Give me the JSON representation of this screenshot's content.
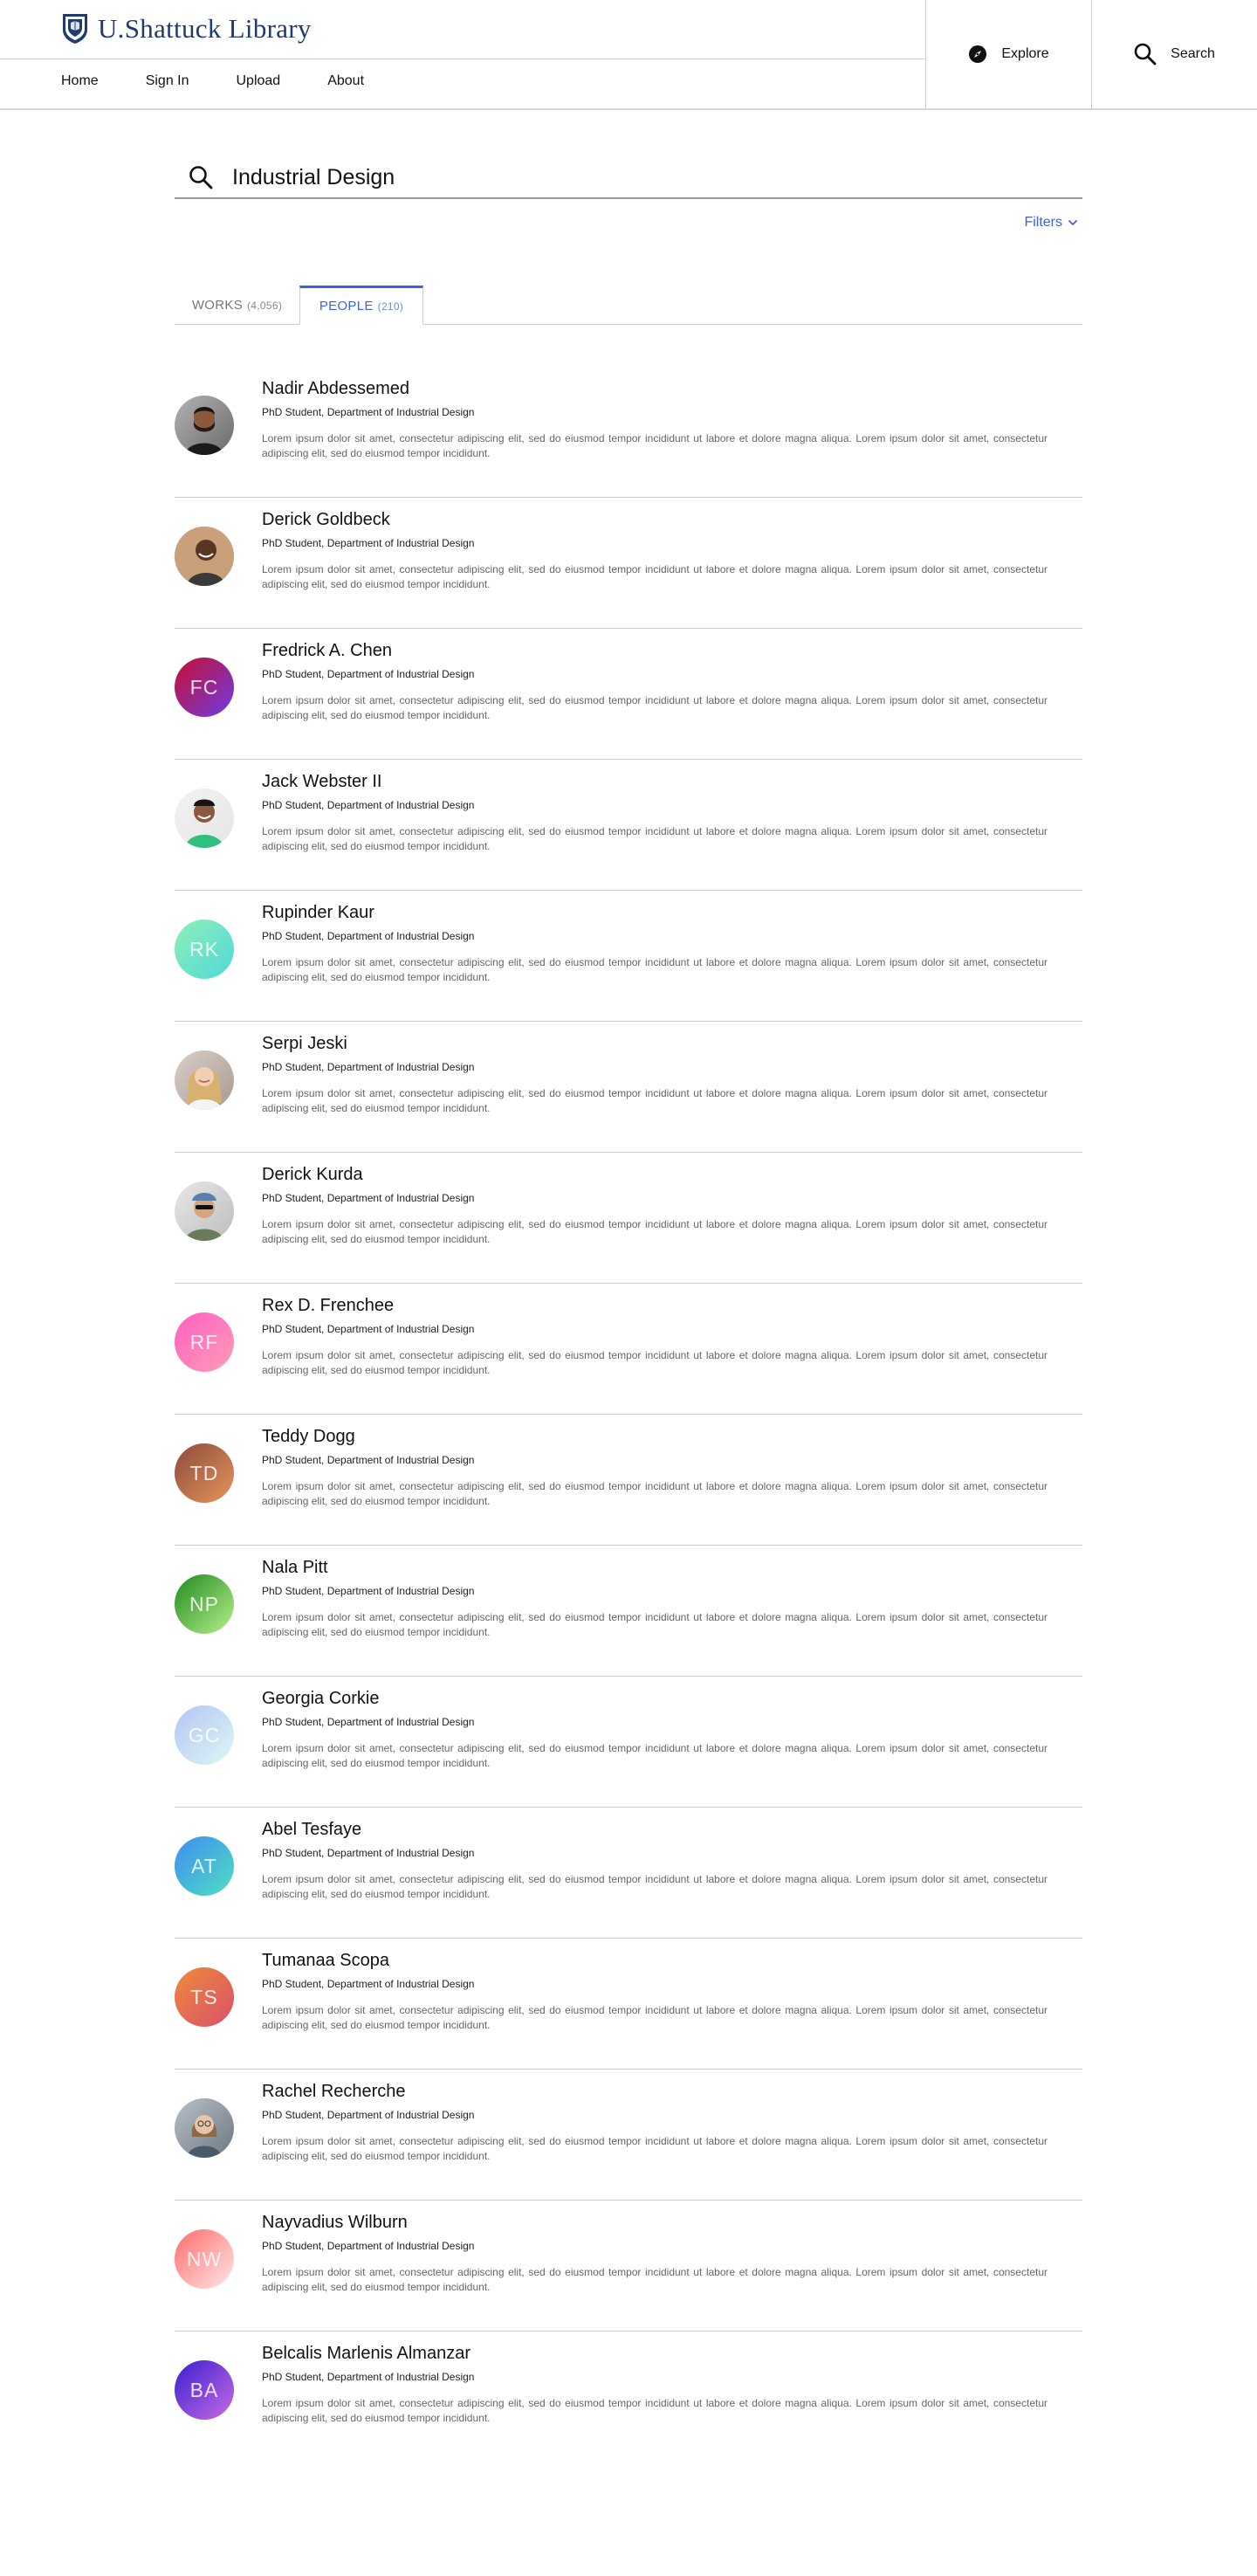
{
  "header": {
    "logo_text": "U.Shattuck Library",
    "nav": [
      {
        "label": "Home"
      },
      {
        "label": "Sign In"
      },
      {
        "label": "Upload"
      },
      {
        "label": "About"
      }
    ],
    "explore_label": "Explore",
    "search_label": "Search",
    "logo_color": "#1f3b6f"
  },
  "search": {
    "query": "Industrial Design",
    "filters_label": "Filters"
  },
  "tabs": {
    "works": {
      "label": "WORKS",
      "count": "(4,056)"
    },
    "people": {
      "label": "PEOPLE",
      "count": "(210)"
    },
    "active": "people",
    "accent": "#3d63d8"
  },
  "people": [
    {
      "name": "Nadir Abdessemed",
      "role": "PhD Student, Department of Industrial Design",
      "desc": "Lorem ipsum dolor sit amet, consectetur adipiscing elit, sed do eiusmod tempor incididunt ut labore et dolore magna aliqua. Lorem ipsum dolor sit amet, consectetur adipiscing elit, sed do eiusmod tempor incididunt.",
      "initials": "",
      "photo": "man-beard",
      "color_from": "#b3b3b3",
      "color_to": "#6a6a6a"
    },
    {
      "name": "Derick Goldbeck",
      "role": "PhD Student, Department of Industrial Design",
      "desc": "Lorem ipsum dolor sit amet, consectetur adipiscing elit, sed do eiusmod tempor incididunt ut labore et dolore magna aliqua. Lorem ipsum dolor sit amet, consectetur adipiscing elit, sed do eiusmod tempor incididunt.",
      "initials": "",
      "photo": "man-smiling",
      "color_from": "#b8c3cc",
      "color_to": "#7a8690"
    },
    {
      "name": "Fredrick A. Chen",
      "role": "PhD Student, Department of Industrial Design",
      "desc": "Lorem ipsum dolor sit amet, consectetur adipiscing elit, sed do eiusmod tempor incididunt ut labore et dolore magna aliqua. Lorem ipsum dolor sit amet, consectetur adipiscing elit, sed do eiusmod tempor incididunt.",
      "initials": "FC",
      "photo": "",
      "color_from": "#c8102e",
      "color_to": "#6d3be6"
    },
    {
      "name": "Jack Webster II",
      "role": "PhD Student, Department of Industrial Design",
      "desc": "Lorem ipsum dolor sit amet, consectetur adipiscing elit, sed do eiusmod tempor incididunt ut labore et dolore magna aliqua. Lorem ipsum dolor sit amet, consectetur adipiscing elit, sed do eiusmod tempor incididunt.",
      "initials": "",
      "photo": "man-green-shirt",
      "color_from": "#f2f2f2",
      "color_to": "#e6e6e6"
    },
    {
      "name": "Rupinder Kaur",
      "role": "PhD Student, Department of Industrial Design",
      "desc": "Lorem ipsum dolor sit amet, consectetur adipiscing elit, sed do eiusmod tempor incididunt ut labore et dolore magna aliqua. Lorem ipsum dolor sit amet, consectetur adipiscing elit, sed do eiusmod tempor incididunt.",
      "initials": "RK",
      "photo": "",
      "color_from": "#8ff0b8",
      "color_to": "#4fd8d8"
    },
    {
      "name": "Serpi Jeski",
      "role": "PhD Student, Department of Industrial Design",
      "desc": "Lorem ipsum dolor sit amet, consectetur adipiscing elit, sed do eiusmod tempor incididunt ut labore et dolore magna aliqua. Lorem ipsum dolor sit amet, consectetur adipiscing elit, sed do eiusmod tempor incididunt.",
      "initials": "",
      "photo": "woman-blonde",
      "color_from": "#d9cfc8",
      "color_to": "#a99a90"
    },
    {
      "name": "Derick Kurda",
      "role": "PhD Student, Department of Industrial Design",
      "desc": "Lorem ipsum dolor sit amet, consectetur adipiscing elit, sed do eiusmod tempor incididunt ut labore et dolore magna aliqua. Lorem ipsum dolor sit amet, consectetur adipiscing elit, sed do eiusmod tempor incididunt.",
      "initials": "",
      "photo": "man-cap-sunglasses",
      "color_from": "#e8e8e8",
      "color_to": "#bdbdbd"
    },
    {
      "name": "Rex D. Frenchee",
      "role": "PhD Student, Department of Industrial Design",
      "desc": "Lorem ipsum dolor sit amet, consectetur adipiscing elit, sed do eiusmod tempor incididunt ut labore et dolore magna aliqua. Lorem ipsum dolor sit amet, consectetur adipiscing elit, sed do eiusmod tempor incididunt.",
      "initials": "RF",
      "photo": "",
      "color_from": "#ff5fc0",
      "color_to": "#ff9db8"
    },
    {
      "name": "Teddy Dogg",
      "role": "PhD Student, Department of Industrial Design",
      "desc": "Lorem ipsum dolor sit amet, consectetur adipiscing elit, sed do eiusmod tempor incididunt ut labore et dolore magna aliqua. Lorem ipsum dolor sit amet, consectetur adipiscing elit, sed do eiusmod tempor incididunt.",
      "initials": "TD",
      "photo": "",
      "color_from": "#8a4b3c",
      "color_to": "#e8955a"
    },
    {
      "name": "Nala Pitt",
      "role": "PhD Student, Department of Industrial Design",
      "desc": "Lorem ipsum dolor sit amet, consectetur adipiscing elit, sed do eiusmod tempor incididunt ut labore et dolore magna aliqua. Lorem ipsum dolor sit amet, consectetur adipiscing elit, sed do eiusmod tempor incididunt.",
      "initials": "NP",
      "photo": "",
      "color_from": "#1f8a1f",
      "color_to": "#b8f08a"
    },
    {
      "name": "Georgia Corkie",
      "role": "PhD Student, Department of Industrial Design",
      "desc": "Lorem ipsum dolor sit amet, consectetur adipiscing elit, sed do eiusmod tempor incididunt ut labore et dolore magna aliqua. Lorem ipsum dolor sit amet, consectetur adipiscing elit, sed do eiusmod tempor incididunt.",
      "initials": "GC",
      "photo": "",
      "color_from": "#b4c4f5",
      "color_to": "#dcf8f5"
    },
    {
      "name": "Abel Tesfaye",
      "role": "PhD Student, Department of Industrial Design",
      "desc": "Lorem ipsum dolor sit amet, consectetur adipiscing elit, sed do eiusmod tempor incididunt ut labore et dolore magna aliqua. Lorem ipsum dolor sit amet, consectetur adipiscing elit, sed do eiusmod tempor incididunt.",
      "initials": "AT",
      "photo": "",
      "color_from": "#3f8cf2",
      "color_to": "#4fe0c0"
    },
    {
      "name": "Tumanaa Scopa",
      "role": "PhD Student, Department of Industrial Design",
      "desc": "Lorem ipsum dolor sit amet, consectetur adipiscing elit, sed do eiusmod tempor incididunt ut labore et dolore magna aliqua. Lorem ipsum dolor sit amet, consectetur adipiscing elit, sed do eiusmod tempor incididunt.",
      "initials": "TS",
      "photo": "",
      "color_from": "#f08a3a",
      "color_to": "#d8506a"
    },
    {
      "name": "Rachel Recherche",
      "role": "PhD Student, Department of Industrial Design",
      "desc": "Lorem ipsum dolor sit amet, consectetur adipiscing elit, sed do eiusmod tempor incididunt ut labore et dolore magna aliqua. Lorem ipsum dolor sit amet, consectetur adipiscing elit, sed do eiusmod tempor incididunt.",
      "initials": "",
      "photo": "woman-glasses",
      "color_from": "#b8c0c8",
      "color_to": "#6e7882"
    },
    {
      "name": "Nayvadius Wilburn",
      "role": "PhD Student, Department of Industrial Design",
      "desc": "Lorem ipsum dolor sit amet, consectetur adipiscing elit, sed do eiusmod tempor incididunt ut labore et dolore magna aliqua. Lorem ipsum dolor sit amet, consectetur adipiscing elit, sed do eiusmod tempor incididunt.",
      "initials": "NW",
      "photo": "",
      "color_from": "#ff6b6b",
      "color_to": "#ffe8e8"
    },
    {
      "name": "Belcalis Marlenis Almanzar",
      "role": "PhD Student, Department of Industrial Design",
      "desc": "Lorem ipsum dolor sit amet, consectetur adipiscing elit, sed do eiusmod tempor incididunt ut labore et dolore magna aliqua. Lorem ipsum dolor sit amet, consectetur adipiscing elit, sed do eiusmod tempor incididunt.",
      "initials": "BA",
      "photo": "",
      "color_from": "#3a1fcf",
      "color_to": "#c86be6"
    }
  ]
}
